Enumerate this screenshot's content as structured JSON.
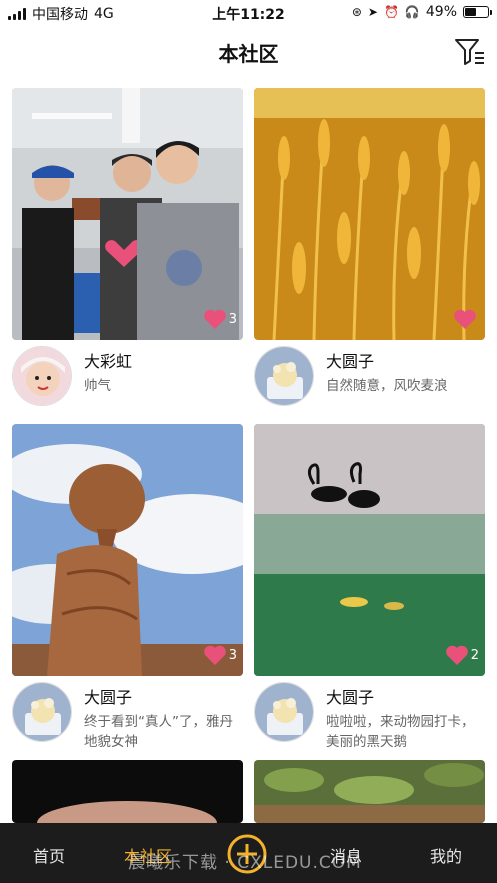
{
  "status_bar": {
    "carrier": "中国移动",
    "network": "4G",
    "time": "上午11:22",
    "battery": "49%",
    "battery_level": 0.49
  },
  "header": {
    "title": "本社区",
    "filter_icon": "filter-icon"
  },
  "posts": [
    {
      "author": "大彩虹",
      "desc": "帅气",
      "likes": "3",
      "image": "photo-three-young-men",
      "avatar": "avatar-baby"
    },
    {
      "author": "大圆子",
      "desc": "自然随意，风吹麦浪",
      "likes": "",
      "image": "photo-wheat-field",
      "avatar": "avatar-cartoon"
    },
    {
      "author": "大圆子",
      "desc": "终于看到“真人”了，雅丹地貌女神",
      "likes": "3",
      "image": "photo-rock-formation",
      "avatar": "avatar-cartoon"
    },
    {
      "author": "大圆子",
      "desc": "啦啦啦，来动物园打卡，美丽的黑天鹅",
      "likes": "2",
      "image": "photo-black-swans",
      "avatar": "avatar-cartoon"
    }
  ],
  "tab_bar": {
    "home": "首页",
    "community": "本社区",
    "messages": "消息",
    "mine": "我的",
    "add_icon": "plus-circle-icon"
  },
  "watermark": "晨曦乐下载 · CXLEDU.COM",
  "colors": {
    "accent": "#f3b12c",
    "heart": "#e9517a",
    "tab_bar_bg": "#1c1c1c"
  }
}
